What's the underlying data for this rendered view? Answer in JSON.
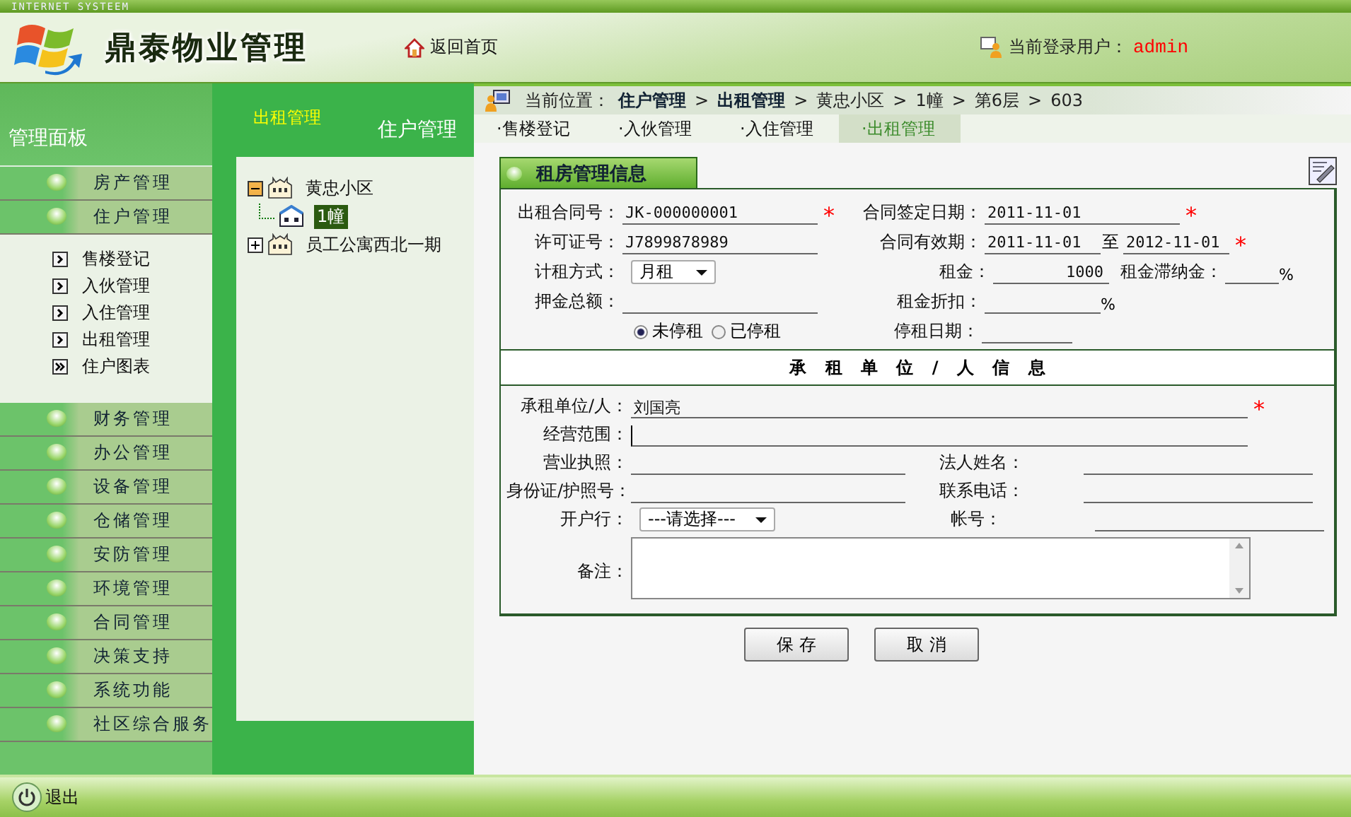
{
  "header": {
    "tagline": "INTERNET SYSTEEM",
    "app_title": "鼎泰物业管理",
    "home_link": "返回首页",
    "user_label": "当前登录用户：",
    "username": "admin"
  },
  "sidebar": {
    "title": "管理面板",
    "items": [
      {
        "label": "房产管理"
      },
      {
        "label": "住户管理",
        "expanded": true,
        "children": [
          {
            "label": "售楼登记",
            "kind": "page"
          },
          {
            "label": "入伙管理",
            "kind": "page"
          },
          {
            "label": "入住管理",
            "kind": "page"
          },
          {
            "label": "出租管理",
            "kind": "page"
          },
          {
            "label": "住户图表",
            "kind": "report"
          }
        ]
      },
      {
        "label": "财务管理"
      },
      {
        "label": "办公管理"
      },
      {
        "label": "设备管理"
      },
      {
        "label": "仓储管理"
      },
      {
        "label": "安防管理"
      },
      {
        "label": "环境管理"
      },
      {
        "label": "合同管理"
      },
      {
        "label": "决策支持"
      },
      {
        "label": "系统功能"
      },
      {
        "label": "社区综合服务"
      }
    ]
  },
  "tree_panel": {
    "subtitle": "出租管理",
    "title": "住户管理",
    "nodes": [
      {
        "label": "黄忠小区",
        "expanded": true,
        "selected": false,
        "children": [
          {
            "label": "1幢",
            "selected": true
          }
        ]
      },
      {
        "label": "员工公寓西北一期",
        "expanded": false,
        "selected": false
      }
    ]
  },
  "breadcrumb": {
    "label": "当前位置：",
    "separator": ">",
    "path": [
      {
        "text": "住户管理",
        "bold": true
      },
      {
        "text": "出租管理",
        "bold": true
      },
      {
        "text": "黄忠小区",
        "bold": false
      },
      {
        "text": "1幢",
        "bold": false
      },
      {
        "text": "第6层",
        "bold": false
      },
      {
        "text": "603",
        "bold": false
      }
    ]
  },
  "tabs": [
    {
      "label": "·售楼登记",
      "selected": false
    },
    {
      "label": "·入伙管理",
      "selected": false
    },
    {
      "label": "·入住管理",
      "selected": false
    },
    {
      "label": "·出租管理",
      "selected": true
    }
  ],
  "form": {
    "title": "租房管理信息",
    "required_mark": "*",
    "contract_no": {
      "label": "出租合同号：",
      "value": "JK-000000001",
      "required": true
    },
    "permit_no": {
      "label": "许可证号：",
      "value": "J7899878989"
    },
    "billing": {
      "label": "计租方式：",
      "value": "月租"
    },
    "deposit": {
      "label": "押金总额："
    },
    "status_options": [
      {
        "label": "未停租",
        "selected": true
      },
      {
        "label": "已停租",
        "selected": false
      }
    ],
    "signed_date": {
      "label": "合同签定日期：",
      "value": "2011-11-01",
      "required": true
    },
    "valid_period": {
      "label": "合同有效期：",
      "from": "2011-11-01",
      "joiner": "至",
      "to": "2012-11-01",
      "required": true
    },
    "rent": {
      "label": "租金：",
      "value": "1000"
    },
    "late_fee": {
      "label": "租金滞纳金：",
      "unit": "%"
    },
    "discount": {
      "label": "租金折扣：",
      "unit": "%"
    },
    "stop_date": {
      "label": "停租日期："
    }
  },
  "tenant": {
    "heading": "承租单位/人信息",
    "name": {
      "label": "承租单位/人：",
      "value": "刘国亮",
      "required": true
    },
    "business_scope": {
      "label": "经营范围："
    },
    "license": {
      "label": "营业执照："
    },
    "legal_person": {
      "label": "法人姓名："
    },
    "id_no": {
      "label": "身份证/护照号："
    },
    "phone": {
      "label": "联系电话："
    },
    "bank": {
      "label": "开户行：",
      "value": "---请选择---"
    },
    "account": {
      "label": "帐号："
    },
    "remarks": {
      "label": "备注："
    }
  },
  "buttons": [
    "保 存",
    "取 消"
  ],
  "footer": {
    "exit": "退出"
  }
}
